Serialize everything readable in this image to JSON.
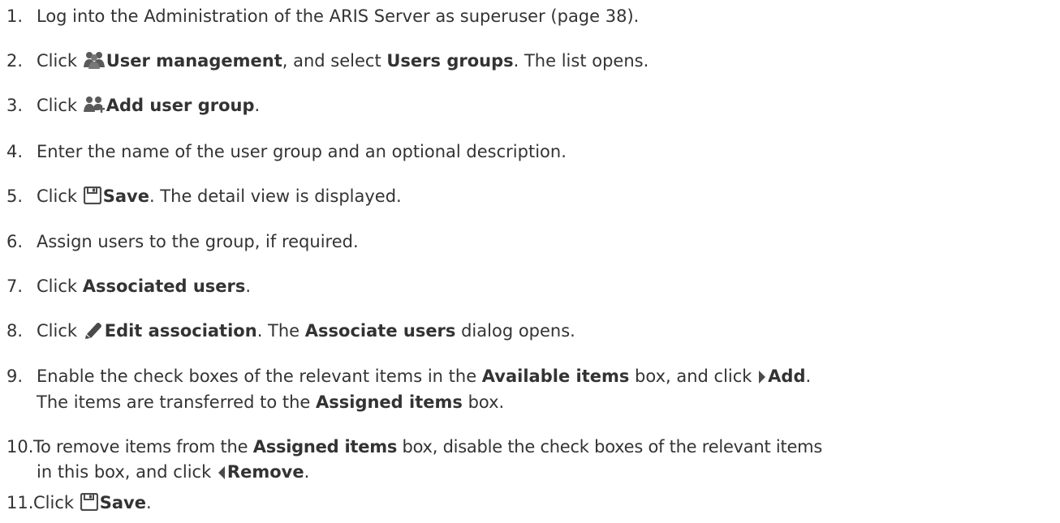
{
  "steps": [
    {
      "num": "1.",
      "parts": [
        "Log into the Administration of the ARIS Server as superuser (page 38)."
      ]
    },
    {
      "num": "2.",
      "parts": [
        "Click ",
        "User management",
        ", and select ",
        "Users groups",
        ". The list opens."
      ]
    },
    {
      "num": "3.",
      "parts": [
        "Click ",
        "Add user group",
        "."
      ]
    },
    {
      "num": "4.",
      "parts": [
        "Enter the name of the user group and an optional description."
      ]
    },
    {
      "num": "5.",
      "parts": [
        "Click ",
        "Save",
        ". The detail view is displayed."
      ]
    },
    {
      "num": "6.",
      "parts": [
        "Assign users to the group, if required."
      ]
    },
    {
      "num": "7.",
      "parts": [
        "Click ",
        "Associated users",
        "."
      ]
    },
    {
      "num": "8.",
      "parts": [
        "Click ",
        "Edit association",
        ". The ",
        "Associate users",
        " dialog opens."
      ]
    },
    {
      "num": "9.",
      "parts": [
        "Enable the check boxes of the relevant items in the ",
        "Available items",
        " box, and click ",
        "Add",
        ".",
        "The items are transferred to the ",
        "Assigned items",
        " box."
      ]
    },
    {
      "num": "10.",
      "parts": [
        "To remove items from the ",
        "Assigned items",
        " box, disable the check boxes of the relevant items",
        "in this box, and click ",
        "Remove",
        "."
      ]
    },
    {
      "num": "11.",
      "parts": [
        "Click ",
        "Save",
        "."
      ]
    }
  ],
  "icons": {
    "user_management": "user-management-icon",
    "add_user_group": "add-user-group-icon",
    "save": "save-icon",
    "edit": "pencil-icon",
    "add_arrow": "arrow-right-icon",
    "remove_arrow": "arrow-left-icon"
  },
  "colors": {
    "text": "#333333",
    "icon": "#5a5a5a"
  }
}
